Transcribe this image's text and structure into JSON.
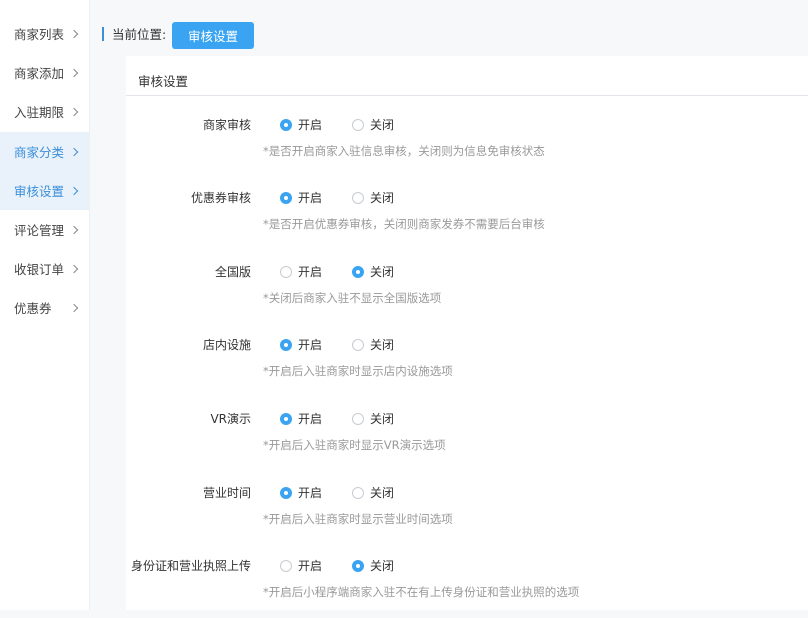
{
  "sidebar": {
    "items": [
      {
        "label": "商家列表",
        "active": false
      },
      {
        "label": "商家添加",
        "active": false
      },
      {
        "label": "入驻期限",
        "active": false
      },
      {
        "label": "商家分类",
        "active": true
      },
      {
        "label": "审核设置",
        "active": true
      },
      {
        "label": "评论管理",
        "active": false
      },
      {
        "label": "收银订单",
        "active": false
      },
      {
        "label": "优惠券",
        "active": false
      }
    ]
  },
  "breadcrumb": {
    "label": "当前位置:",
    "current": "审核设置"
  },
  "panel": {
    "title": "审核设置",
    "options": {
      "on": "开启",
      "off": "关闭"
    },
    "rows": [
      {
        "label": "商家审核",
        "value": "on",
        "hint": "*是否开启商家入驻信息审核，关闭则为信息免审核状态"
      },
      {
        "label": "优惠券审核",
        "value": "on",
        "hint": "*是否开启优惠券审核，关闭则商家发券不需要后台审核"
      },
      {
        "label": "全国版",
        "value": "off",
        "hint": "*关闭后商家入驻不显示全国版选项"
      },
      {
        "label": "店内设施",
        "value": "on",
        "hint": "*开启后入驻商家时显示店内设施选项"
      },
      {
        "label": "VR演示",
        "value": "on",
        "hint": "*开启后入驻商家时显示VR演示选项"
      },
      {
        "label": "营业时间",
        "value": "on",
        "hint": "*开启后入驻商家时显示营业时间选项"
      },
      {
        "label": "身份证和营业执照上传",
        "value": "off",
        "hint": "*开启后小程序端商家入驻不在有上传身份证和营业执照的选项"
      }
    ]
  },
  "colors": {
    "accent": "#3aa4f2",
    "active_bg": "#e9f2fb"
  }
}
